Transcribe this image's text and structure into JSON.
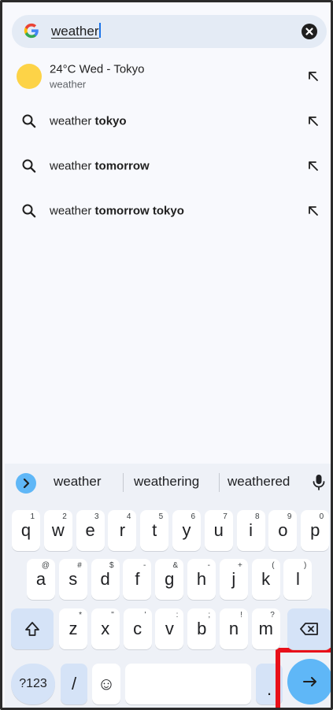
{
  "search": {
    "query": "weather",
    "logo": "google-g-logo",
    "clear_icon": "close-circle-icon"
  },
  "suggestions": [
    {
      "type": "weather",
      "title": "24°C Wed - Tokyo",
      "subtitle": "weather",
      "icon": "sun-icon"
    },
    {
      "type": "query",
      "prefix": "weather ",
      "bold": "tokyo",
      "icon": "search-icon"
    },
    {
      "type": "query",
      "prefix": "weather ",
      "bold": "tomorrow",
      "icon": "search-icon"
    },
    {
      "type": "query",
      "prefix": "weather ",
      "bold": "tomorrow tokyo",
      "icon": "search-icon"
    }
  ],
  "keyboard": {
    "candidates": [
      "weather",
      "weathering",
      "weathered"
    ],
    "row1": [
      {
        "k": "q",
        "h": "1"
      },
      {
        "k": "w",
        "h": "2"
      },
      {
        "k": "e",
        "h": "3"
      },
      {
        "k": "r",
        "h": "4"
      },
      {
        "k": "t",
        "h": "5"
      },
      {
        "k": "y",
        "h": "6"
      },
      {
        "k": "u",
        "h": "7"
      },
      {
        "k": "i",
        "h": "8"
      },
      {
        "k": "o",
        "h": "9"
      },
      {
        "k": "p",
        "h": "0"
      }
    ],
    "row2": [
      {
        "k": "a",
        "h": "@"
      },
      {
        "k": "s",
        "h": "#"
      },
      {
        "k": "d",
        "h": "$"
      },
      {
        "k": "f",
        "h": "-"
      },
      {
        "k": "g",
        "h": "&"
      },
      {
        "k": "h",
        "h": "-"
      },
      {
        "k": "j",
        "h": "+"
      },
      {
        "k": "k",
        "h": "("
      },
      {
        "k": "l",
        "h": ")"
      }
    ],
    "row3": [
      {
        "k": "z",
        "h": "*"
      },
      {
        "k": "x",
        "h": "\""
      },
      {
        "k": "c",
        "h": "'"
      },
      {
        "k": "v",
        "h": ":"
      },
      {
        "k": "b",
        "h": ";"
      },
      {
        "k": "n",
        "h": "!"
      },
      {
        "k": "m",
        "h": "?"
      }
    ],
    "symbols_label": "?123",
    "slash": "/",
    "period": ".",
    "emoji": "☺",
    "shift_icon": "shift-icon",
    "backspace_icon": "backspace-icon",
    "enter_icon": "arrow-right-icon",
    "mic_icon": "mic-icon"
  },
  "colors": {
    "accent": "#5fb7f7",
    "highlight_box": "#e8101a",
    "sun": "#fdd347"
  }
}
